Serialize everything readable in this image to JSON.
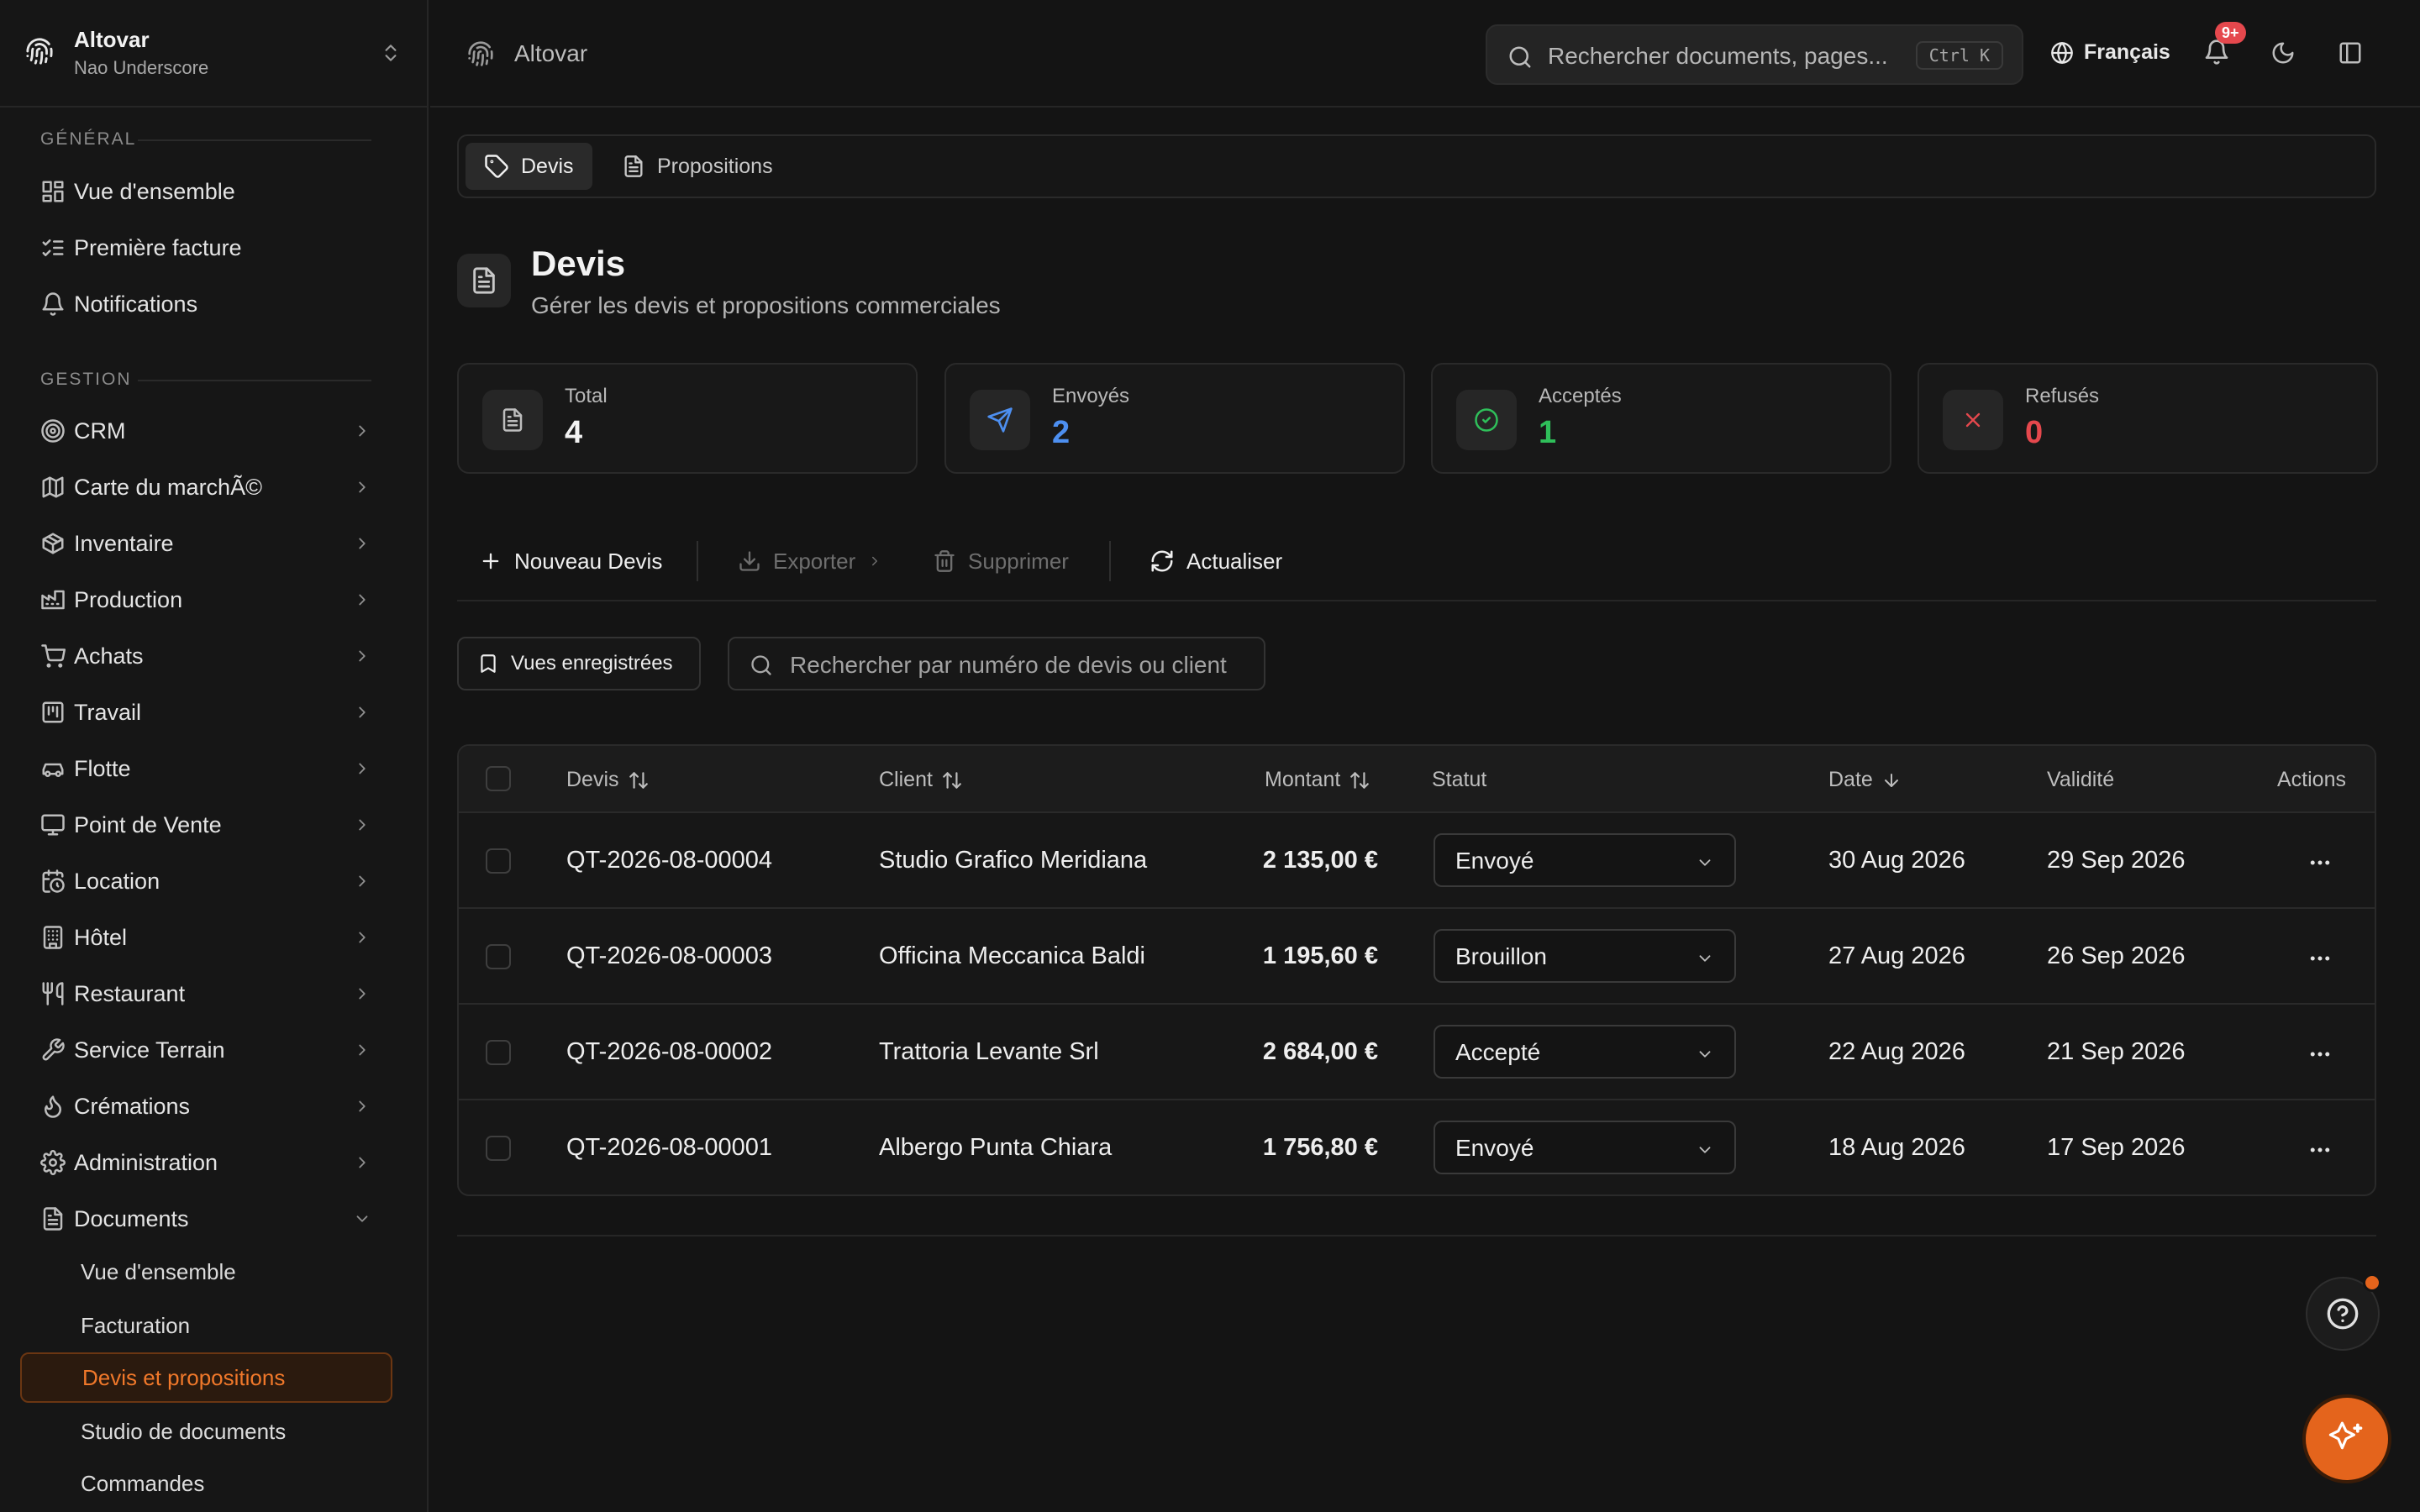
{
  "workspace": {
    "name": "Altovar",
    "user": "Nao Underscore"
  },
  "sidebar": {
    "general_title": "GÉNÉRAL",
    "general_items": [
      {
        "label": "Vue d'ensemble",
        "icon": "dashboard-icon"
      },
      {
        "label": "Première facture",
        "icon": "checklist-icon"
      },
      {
        "label": "Notifications",
        "icon": "bell-icon"
      }
    ],
    "gestion_title": "GESTION",
    "gestion_items": [
      {
        "label": "CRM",
        "icon": "target-icon"
      },
      {
        "label": "Carte du marchÃ©",
        "icon": "map-icon"
      },
      {
        "label": "Inventaire",
        "icon": "package-icon"
      },
      {
        "label": "Production",
        "icon": "factory-icon"
      },
      {
        "label": "Achats",
        "icon": "cart-icon"
      },
      {
        "label": "Travail",
        "icon": "kanban-icon"
      },
      {
        "label": "Flotte",
        "icon": "car-icon"
      },
      {
        "label": "Point de Vente",
        "icon": "monitor-icon"
      },
      {
        "label": "Location",
        "icon": "calendar-clock-icon"
      },
      {
        "label": "Hôtel",
        "icon": "building-icon"
      },
      {
        "label": "Restaurant",
        "icon": "utensils-icon"
      },
      {
        "label": "Service Terrain",
        "icon": "wrench-icon"
      },
      {
        "label": "Crémations",
        "icon": "flame-icon"
      },
      {
        "label": "Administration",
        "icon": "gear-icon"
      },
      {
        "label": "Documents",
        "icon": "file-icon"
      }
    ],
    "documents_sub": [
      {
        "label": "Vue d'ensemble"
      },
      {
        "label": "Facturation"
      },
      {
        "label": "Devis et propositions"
      },
      {
        "label": "Studio de documents"
      },
      {
        "label": "Commandes"
      }
    ]
  },
  "topbar": {
    "app_name": "Altovar",
    "search_placeholder": "Rechercher documents, pages...",
    "shortcut": "Ctrl K",
    "language": "Français",
    "notif_badge": "9+"
  },
  "tabs": [
    {
      "label": "Devis"
    },
    {
      "label": "Propositions"
    }
  ],
  "page": {
    "title": "Devis",
    "subtitle": "Gérer les devis et propositions commerciales"
  },
  "stats": [
    {
      "label": "Total",
      "value": "4",
      "color": "#f2f2f2"
    },
    {
      "label": "Envoyés",
      "value": "2",
      "color": "#4d8ff0"
    },
    {
      "label": "Acceptés",
      "value": "1",
      "color": "#2fbf5a"
    },
    {
      "label": "Refusés",
      "value": "0",
      "color": "#e5484d"
    }
  ],
  "toolbar": {
    "new_label": "Nouveau Devis",
    "export_label": "Exporter",
    "delete_label": "Supprimer",
    "refresh_label": "Actualiser"
  },
  "filters": {
    "saved_views": "Vues enregistrées",
    "search_placeholder": "Rechercher par numéro de devis ou client"
  },
  "table": {
    "headers": {
      "devis": "Devis",
      "client": "Client",
      "montant": "Montant",
      "statut": "Statut",
      "date": "Date",
      "validite": "Validité",
      "actions": "Actions"
    },
    "rows": [
      {
        "devis": "QT-2026-08-00004",
        "client": "Studio Grafico Meridiana",
        "montant": "2 135,00 €",
        "statut": "Envoyé",
        "date": "30 Aug 2026",
        "validite": "29 Sep 2026"
      },
      {
        "devis": "QT-2026-08-00003",
        "client": "Officina Meccanica Baldi",
        "montant": "1 195,60 €",
        "statut": "Brouillon",
        "date": "27 Aug 2026",
        "validite": "26 Sep 2026"
      },
      {
        "devis": "QT-2026-08-00002",
        "client": "Trattoria Levante Srl",
        "montant": "2 684,00 €",
        "statut": "Accepté",
        "date": "22 Aug 2026",
        "validite": "21 Sep 2026"
      },
      {
        "devis": "QT-2026-08-00001",
        "client": "Albergo Punta Chiara",
        "montant": "1 756,80 €",
        "statut": "Envoyé",
        "date": "18 Aug 2026",
        "validite": "17 Sep 2026"
      }
    ]
  },
  "colors": {
    "accent": "#e4641c",
    "background": "#141414"
  }
}
